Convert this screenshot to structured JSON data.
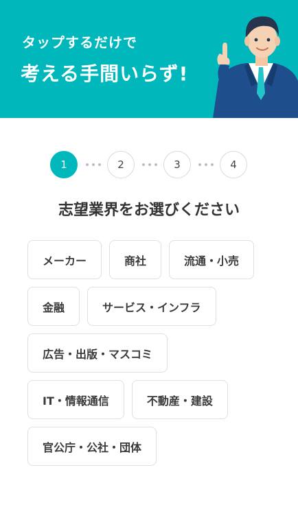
{
  "banner": {
    "subtitle": "タップするだけで",
    "headline": "考える手間いらず!"
  },
  "steps": [
    "1",
    "2",
    "3",
    "4"
  ],
  "current_step": 1,
  "question": "志望業界をお選びください",
  "choices": [
    [
      "メーカー",
      "商社",
      "流通・小売"
    ],
    [
      "金融",
      "サービス・インフラ"
    ],
    [
      "広告・出版・マスコミ"
    ],
    [
      "IT・情報通信",
      "不動産・建設"
    ],
    [
      "官公庁・公社・団体"
    ]
  ],
  "colors": {
    "accent": "#00b8bc",
    "text": "#333333",
    "border": "#e0e0e0"
  }
}
